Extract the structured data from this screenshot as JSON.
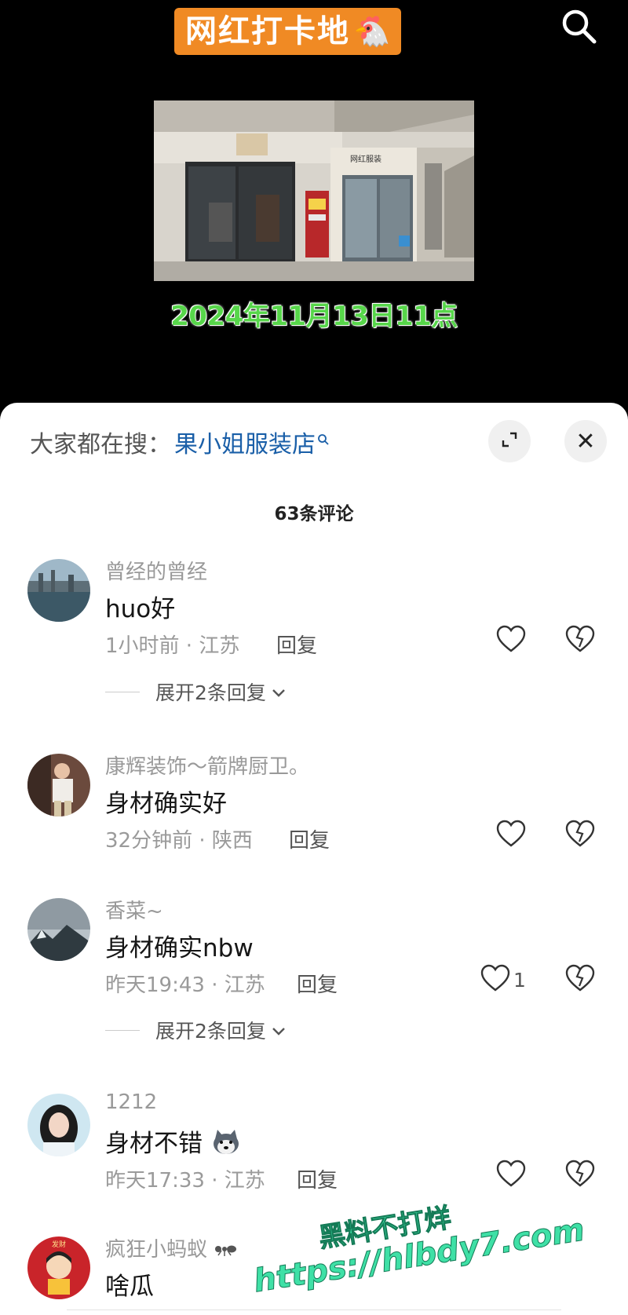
{
  "video": {
    "title": "网红打卡地",
    "title_emoji": "🐔",
    "date_caption": "2024年11月13日11点"
  },
  "panel": {
    "search_prefix": "大家都在搜：",
    "search_term": "果小姐服装店",
    "comment_count": "63条评论",
    "close_glyph": "✕"
  },
  "comments": [
    {
      "user": "曾经的曾经",
      "text": "huo好",
      "time_loc": "1小时前 · 江苏",
      "reply": "回复",
      "likes": "",
      "expand": "展开2条回复"
    },
    {
      "user": "康辉装饰～箭牌厨卫。",
      "text": "身材确实好",
      "time_loc": "32分钟前 · 陕西",
      "reply": "回复",
      "likes": ""
    },
    {
      "user": "香菜~",
      "text": "身材确实nbw",
      "time_loc": "昨天19:43 · 江苏",
      "reply": "回复",
      "likes": "1",
      "expand": "展开2条回复"
    },
    {
      "user": "1212",
      "text": "身材不错",
      "time_loc": "昨天17:33 · 江苏",
      "reply": "回复",
      "likes": ""
    },
    {
      "user": "疯狂小蚂蚁",
      "text": "啥瓜"
    }
  ],
  "watermark": {
    "line1": "黑料不打烊",
    "line2": "https://hlbdy7.com"
  },
  "colors": {
    "accent_link": "#1a5fa8",
    "title_bg": "#f08a24",
    "date_text": "#57d64a"
  }
}
